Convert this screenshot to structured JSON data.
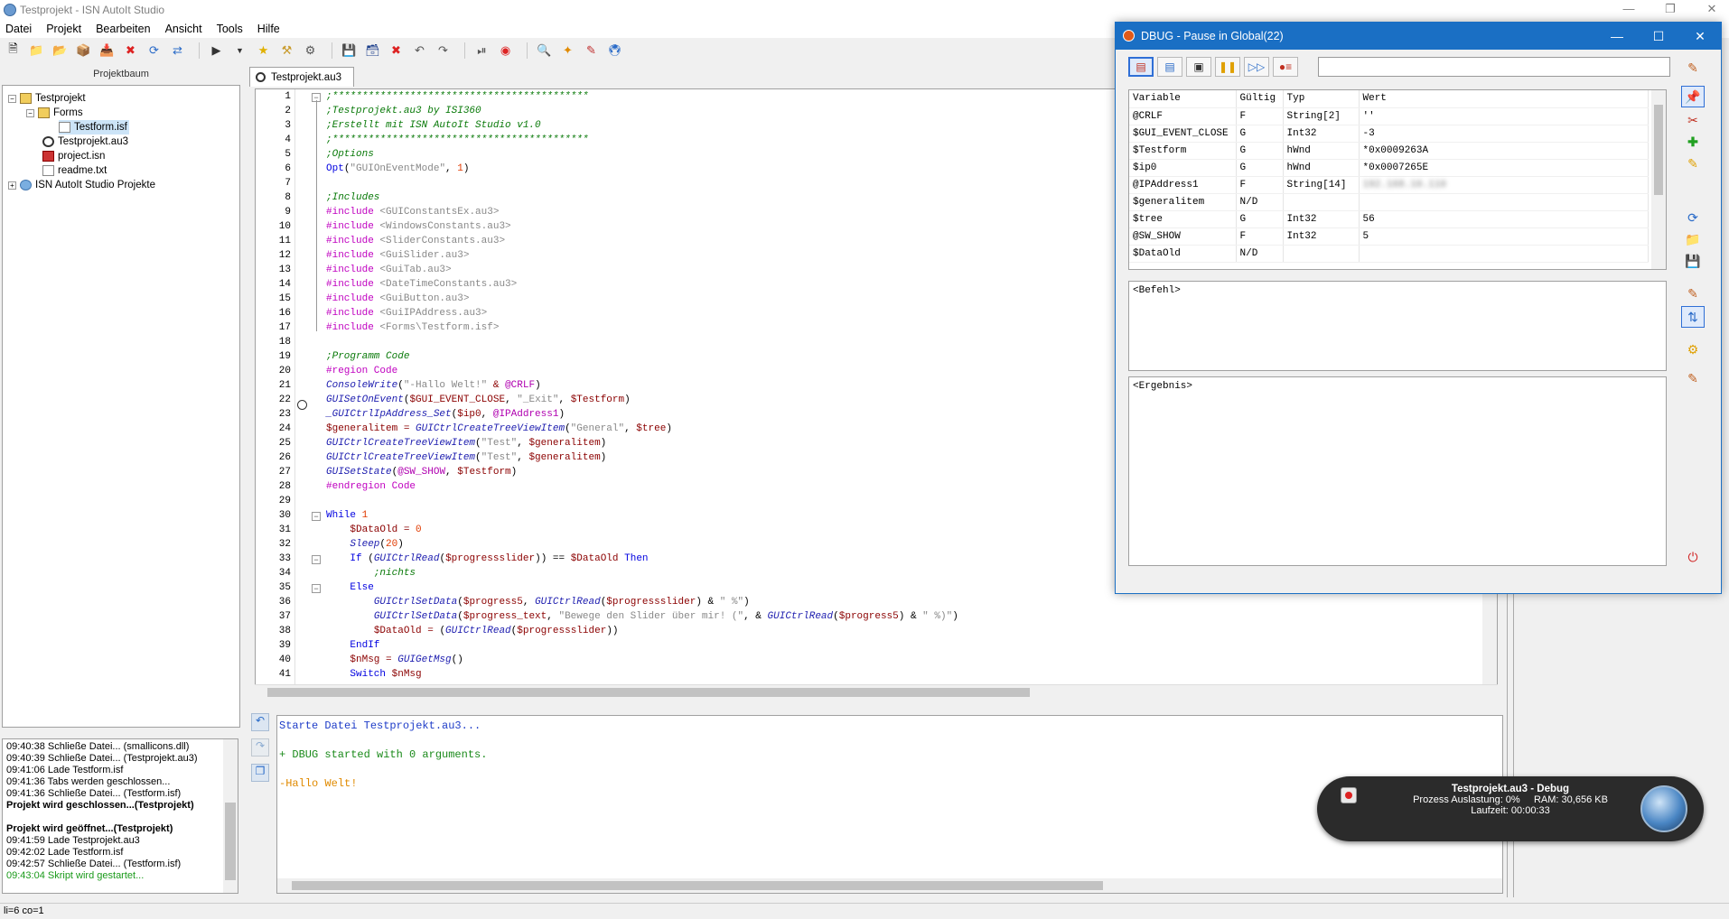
{
  "window": {
    "title": "Testprojekt - ISN AutoIt Studio"
  },
  "menu": [
    "Datei",
    "Projekt",
    "Bearbeiten",
    "Ansicht",
    "Tools",
    "Hilfe"
  ],
  "project_panel": {
    "header": "Projektbaum",
    "tree": [
      "Testprojekt",
      "Forms",
      "Testform.isf",
      "Testprojekt.au3",
      "project.isn",
      "readme.txt",
      "ISN AutoIt Studio Projekte"
    ]
  },
  "log": [
    {
      "text": "09:40:38  Schließe Datei... (smallicons.dll)",
      "style": "normal"
    },
    {
      "text": "09:40:39  Schließe Datei... (Testprojekt.au3)",
      "style": "normal"
    },
    {
      "text": "09:41:06  Lade Testform.isf",
      "style": "normal"
    },
    {
      "text": "09:41:36  Tabs werden geschlossen...",
      "style": "normal"
    },
    {
      "text": "09:41:36  Schließe Datei... (Testform.isf)",
      "style": "normal"
    },
    {
      "text": "Projekt wird geschlossen...(Testprojekt)",
      "style": "bold"
    },
    {
      "text": "",
      "style": "normal"
    },
    {
      "text": "Projekt wird geöffnet...(Testprojekt)",
      "style": "bold"
    },
    {
      "text": "09:41:59  Lade Testprojekt.au3",
      "style": "normal"
    },
    {
      "text": "09:42:02  Lade Testform.isf",
      "style": "normal"
    },
    {
      "text": "09:42:57  Schließe Datei... (Testform.isf)",
      "style": "normal"
    },
    {
      "text": "09:43:04  Skript wird gestartet...",
      "style": "green"
    }
  ],
  "editor": {
    "tab": "Testprojekt.au3",
    "lines": [
      [
        [
          "c-com",
          ";*******************************************"
        ]
      ],
      [
        [
          "c-com",
          ";Testprojekt.au3 by ISI360"
        ]
      ],
      [
        [
          "c-com",
          ";Erstellt mit ISN AutoIt Studio v1.0"
        ]
      ],
      [
        [
          "c-com",
          ";*******************************************"
        ]
      ],
      [
        [
          "c-com",
          ";Options"
        ]
      ],
      [
        [
          "c-kw",
          "Opt"
        ],
        [
          "",
          "("
        ],
        [
          "c-str",
          "\"GUIOnEventMode\""
        ],
        [
          "",
          ", "
        ],
        [
          "c-num",
          "1"
        ],
        [
          "",
          ")"
        ]
      ],
      [],
      [
        [
          "c-com",
          ";Includes"
        ]
      ],
      [
        [
          "c-inc",
          "#include "
        ],
        [
          "c-str",
          "<GUIConstantsEx.au3>"
        ]
      ],
      [
        [
          "c-inc",
          "#include "
        ],
        [
          "c-str",
          "<WindowsConstants.au3>"
        ]
      ],
      [
        [
          "c-inc",
          "#include "
        ],
        [
          "c-str",
          "<SliderConstants.au3>"
        ]
      ],
      [
        [
          "c-inc",
          "#include "
        ],
        [
          "c-str",
          "<GuiSlider.au3>"
        ]
      ],
      [
        [
          "c-inc",
          "#include "
        ],
        [
          "c-str",
          "<GuiTab.au3>"
        ]
      ],
      [
        [
          "c-inc",
          "#include "
        ],
        [
          "c-str",
          "<DateTimeConstants.au3>"
        ]
      ],
      [
        [
          "c-inc",
          "#include "
        ],
        [
          "c-str",
          "<GuiButton.au3>"
        ]
      ],
      [
        [
          "c-inc",
          "#include "
        ],
        [
          "c-str",
          "<GuiIPAddress.au3>"
        ]
      ],
      [
        [
          "c-inc",
          "#include "
        ],
        [
          "c-str",
          "<Forms\\Testform.isf>"
        ]
      ],
      [],
      [
        [
          "c-com",
          ";Programm Code"
        ]
      ],
      [
        [
          "c-inc",
          "#region Code"
        ]
      ],
      [
        [
          "c-fn",
          "ConsoleWrite"
        ],
        [
          "",
          "("
        ],
        [
          "c-str",
          "\"-Hallo Welt!\""
        ],
        [
          "c-var",
          " & "
        ],
        [
          "c-mac",
          "@CRLF"
        ],
        [
          "",
          ")"
        ]
      ],
      [
        [
          "c-fn",
          "GUISetOnEvent"
        ],
        [
          "",
          "("
        ],
        [
          "c-var",
          "$GUI_EVENT_CLOSE"
        ],
        [
          "",
          ", "
        ],
        [
          "c-str",
          "\"_Exit\""
        ],
        [
          "",
          ", "
        ],
        [
          "c-var",
          "$Testform"
        ],
        [
          "",
          ")"
        ]
      ],
      [
        [
          "c-fn",
          "_GUICtrlIpAddress_Set"
        ],
        [
          "",
          "("
        ],
        [
          "c-var",
          "$ip0"
        ],
        [
          "",
          ", "
        ],
        [
          "c-mac",
          "@IPAddress1"
        ],
        [
          "",
          ")"
        ]
      ],
      [
        [
          "c-var",
          "$generalitem = "
        ],
        [
          "c-fn",
          "GUICtrlCreateTreeViewItem"
        ],
        [
          "",
          "("
        ],
        [
          "c-str",
          "\"General\""
        ],
        [
          "",
          ", "
        ],
        [
          "c-var",
          "$tree"
        ],
        [
          "",
          ")"
        ]
      ],
      [
        [
          "c-fn",
          "GUICtrlCreateTreeViewItem"
        ],
        [
          "",
          "("
        ],
        [
          "c-str",
          "\"Test\""
        ],
        [
          "",
          ", "
        ],
        [
          "c-var",
          "$generalitem"
        ],
        [
          "",
          ")"
        ]
      ],
      [
        [
          "c-fn",
          "GUICtrlCreateTreeViewItem"
        ],
        [
          "",
          "("
        ],
        [
          "c-str",
          "\"Test\""
        ],
        [
          "",
          ", "
        ],
        [
          "c-var",
          "$generalitem"
        ],
        [
          "",
          ")"
        ]
      ],
      [
        [
          "c-fn",
          "GUISetState"
        ],
        [
          "",
          "("
        ],
        [
          "c-mac",
          "@SW_SHOW"
        ],
        [
          "",
          ", "
        ],
        [
          "c-var",
          "$Testform"
        ],
        [
          "",
          ")"
        ]
      ],
      [
        [
          "c-inc",
          "#endregion Code"
        ]
      ],
      [],
      [
        [
          "c-kw",
          "While "
        ],
        [
          "c-num",
          "1"
        ]
      ],
      [
        [
          "",
          "    "
        ],
        [
          "c-var",
          "$DataOld = "
        ],
        [
          "c-num",
          "0"
        ]
      ],
      [
        [
          "",
          "    "
        ],
        [
          "c-fn",
          "Sleep"
        ],
        [
          "",
          "("
        ],
        [
          "c-num",
          "20"
        ],
        [
          "",
          ")"
        ]
      ],
      [
        [
          "",
          "    "
        ],
        [
          "c-kw",
          "If "
        ],
        [
          "",
          "("
        ],
        [
          "c-fn",
          "GUICtrlRead"
        ],
        [
          "",
          "("
        ],
        [
          "c-var",
          "$progressslider"
        ],
        [
          "",
          ")) == "
        ],
        [
          "c-var",
          "$DataOld "
        ],
        [
          "c-kw",
          "Then"
        ]
      ],
      [
        [
          "",
          "        "
        ],
        [
          "c-com",
          ";nichts"
        ]
      ],
      [
        [
          "",
          "    "
        ],
        [
          "c-kw",
          "Else"
        ]
      ],
      [
        [
          "",
          "        "
        ],
        [
          "c-fn",
          "GUICtrlSetData"
        ],
        [
          "",
          "("
        ],
        [
          "c-var",
          "$progress5"
        ],
        [
          "",
          ", "
        ],
        [
          "c-fn",
          "GUICtrlRead"
        ],
        [
          "",
          "("
        ],
        [
          "c-var",
          "$progressslider"
        ],
        [
          "",
          ") & "
        ],
        [
          "c-str",
          "\" %\""
        ],
        [
          "",
          ")"
        ]
      ],
      [
        [
          "",
          "        "
        ],
        [
          "c-fn",
          "GUICtrlSetData"
        ],
        [
          "",
          "("
        ],
        [
          "c-var",
          "$progress_text"
        ],
        [
          "",
          ", "
        ],
        [
          "c-str",
          "\"Bewege den Slider über mir! (\""
        ],
        [
          "",
          ", & "
        ],
        [
          "c-fn",
          "GUICtrlRead"
        ],
        [
          "",
          "("
        ],
        [
          "c-var",
          "$progress5"
        ],
        [
          "",
          ") & "
        ],
        [
          "c-str",
          "\" %)\""
        ],
        [
          "",
          ")"
        ]
      ],
      [
        [
          "",
          "        "
        ],
        [
          "c-var",
          "$DataOld = "
        ],
        [
          "",
          "("
        ],
        [
          "c-fn",
          "GUICtrlRead"
        ],
        [
          "",
          "("
        ],
        [
          "c-var",
          "$progressslider"
        ],
        [
          "",
          "))"
        ]
      ],
      [
        [
          "",
          "    "
        ],
        [
          "c-kw",
          "EndIf"
        ]
      ],
      [
        [
          "",
          "    "
        ],
        [
          "c-var",
          "$nMsg = "
        ],
        [
          "c-fn",
          "GUIGetMsg"
        ],
        [
          "",
          "()"
        ]
      ],
      [
        [
          "",
          "    "
        ],
        [
          "c-kw",
          "Switch "
        ],
        [
          "c-var",
          "$nMsg"
        ]
      ]
    ]
  },
  "output": [
    {
      "text": "Starte Datei Testprojekt.au3...",
      "color": "#1e3cc8"
    },
    {
      "text": "+ DBUG started with 0 arguments.",
      "color": "#1a8a1a"
    },
    {
      "text": "-Hallo Welt!",
      "color": "#e08a00"
    }
  ],
  "status": "li=6 co=1",
  "dbug": {
    "title": "DBUG - Pause in Global(22)",
    "columns": [
      "Variable",
      "Gültig",
      "Typ",
      "Wert"
    ],
    "rows": [
      [
        "@CRLF",
        "F",
        "String[2]",
        "''"
      ],
      [
        "$GUI_EVENT_CLOSE",
        "G",
        "Int32",
        "-3"
      ],
      [
        "$Testform",
        "G",
        "hWnd",
        "*0x0009263A"
      ],
      [
        "$ip0",
        "G",
        "hWnd",
        "*0x0007265E"
      ],
      [
        "@IPAddress1",
        "F",
        "String[14]",
        "192.168.10.110"
      ],
      [
        "$generalitem",
        "N/D",
        "",
        ""
      ],
      [
        "$tree",
        "G",
        "Int32",
        "56"
      ],
      [
        "@SW_SHOW",
        "F",
        "Int32",
        "5"
      ],
      [
        "$DataOld",
        "N/D",
        "",
        ""
      ]
    ],
    "befehl": "<Befehl>",
    "ergebnis": "<Ergebnis>"
  },
  "toast": {
    "title": "Testprojekt.au3 - Debug",
    "stats": "Prozess Auslastung: 0%     RAM: 30,656 KB",
    "laufzeit": "Laufzeit: 00:00:33"
  }
}
